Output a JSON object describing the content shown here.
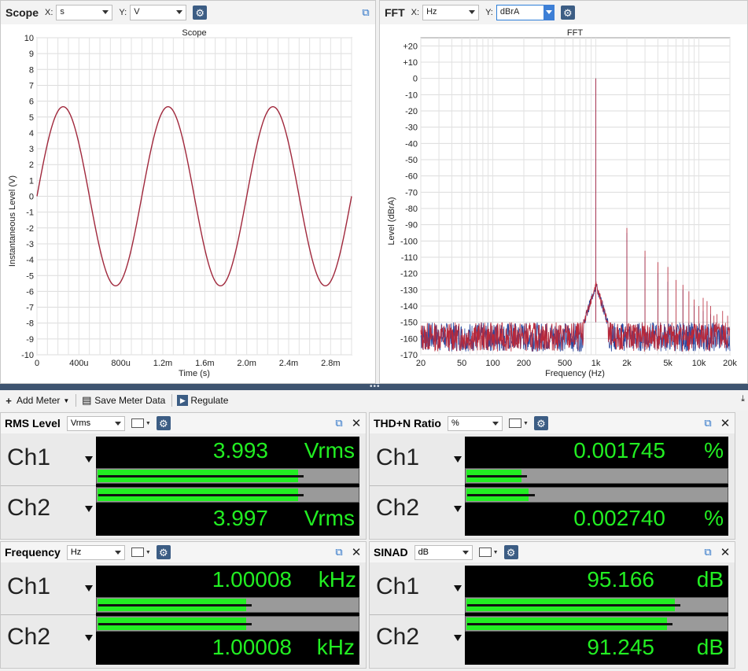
{
  "scope": {
    "title": "Scope",
    "x_label": "X:",
    "x_value": "s",
    "y_label": "Y:",
    "y_value": "V",
    "plot_title": "Scope",
    "y_axis_label": "Instantaneous Level (V)",
    "x_axis_label": "Time (s)",
    "y_ticks": [
      "10",
      "9",
      "8",
      "7",
      "6",
      "5",
      "4",
      "3",
      "2",
      "1",
      "0",
      "-1",
      "-2",
      "-3",
      "-4",
      "-5",
      "-6",
      "-7",
      "-8",
      "-9",
      "-10"
    ],
    "x_ticks": [
      "0",
      "400u",
      "800u",
      "1.2m",
      "1.6m",
      "2.0m",
      "2.4m",
      "2.8m"
    ]
  },
  "fft": {
    "title": "FFT",
    "x_label": "X:",
    "x_value": "Hz",
    "y_label": "Y:",
    "y_value": "dBrA",
    "plot_title": "FFT",
    "y_axis_label": "Level (dBrA)",
    "x_axis_label": "Frequency (Hz)",
    "y_ticks": [
      "+20",
      "+10",
      "0",
      "-10",
      "-20",
      "-30",
      "-40",
      "-50",
      "-60",
      "-70",
      "-80",
      "-90",
      "-100",
      "-110",
      "-120",
      "-130",
      "-140",
      "-150",
      "-160",
      "-170"
    ],
    "x_ticks": [
      "20",
      "50",
      "100",
      "200",
      "500",
      "1k",
      "2k",
      "5k",
      "10k",
      "20k"
    ]
  },
  "toolbar": {
    "add_meter": "Add Meter",
    "save_meter_data": "Save Meter Data",
    "regulate": "Regulate"
  },
  "meters": {
    "rms": {
      "title": "RMS Level",
      "unit_select": "Vrms",
      "ch1": {
        "label": "Ch1",
        "value": "3.993",
        "unit": "Vrms",
        "bar_fraction": 0.77
      },
      "ch2": {
        "label": "Ch2",
        "value": "3.997",
        "unit": "Vrms",
        "bar_fraction": 0.77
      }
    },
    "thdn": {
      "title": "THD+N Ratio",
      "unit_select": "%",
      "ch1": {
        "label": "Ch1",
        "value": "0.001745",
        "unit": "%",
        "bar_fraction": 0.21
      },
      "ch2": {
        "label": "Ch2",
        "value": "0.002740",
        "unit": "%",
        "bar_fraction": 0.24
      }
    },
    "freq": {
      "title": "Frequency",
      "unit_select": "Hz",
      "ch1": {
        "label": "Ch1",
        "value": "1.00008",
        "unit": "kHz",
        "bar_fraction": 0.57
      },
      "ch2": {
        "label": "Ch2",
        "value": "1.00008",
        "unit": "kHz",
        "bar_fraction": 0.57
      }
    },
    "sinad": {
      "title": "SINAD",
      "unit_select": "dB",
      "ch1": {
        "label": "Ch1",
        "value": "95.166",
        "unit": "dB",
        "bar_fraction": 0.8
      },
      "ch2": {
        "label": "Ch2",
        "value": "91.245",
        "unit": "dB",
        "bar_fraction": 0.77
      }
    }
  },
  "colors": {
    "accent": "#3c5d84",
    "meter_green": "#22ee22",
    "trace": "#a0283c",
    "trace2": "#2848a0"
  },
  "icons": {
    "settings": "gear-icon",
    "popout": "popout-icon",
    "close": "close-icon",
    "graph": "graph-icon"
  }
}
